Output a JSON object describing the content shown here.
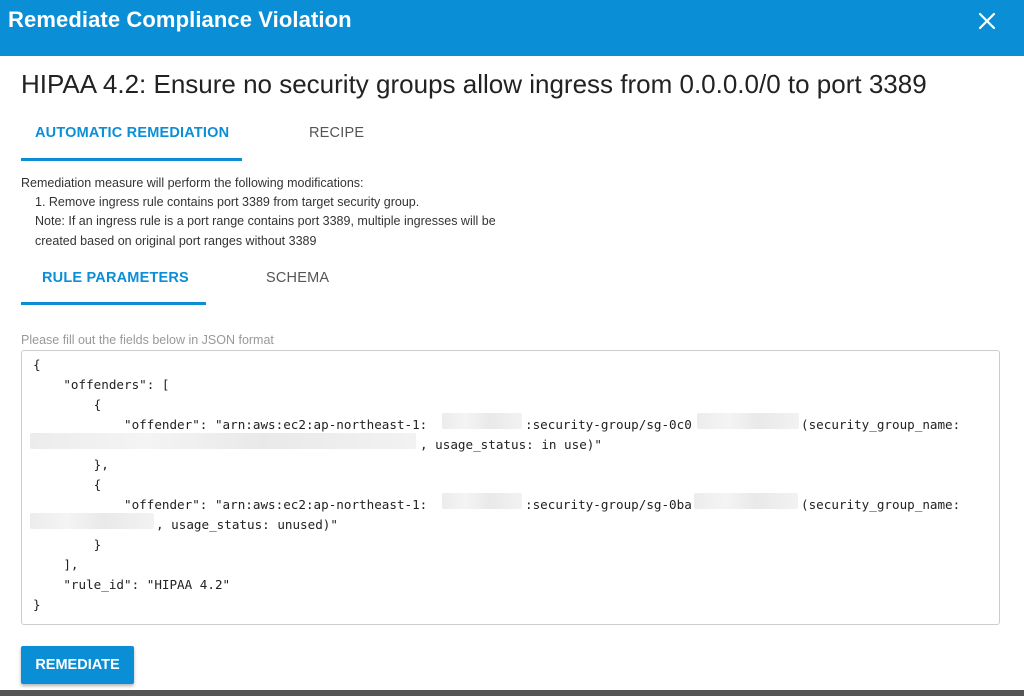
{
  "dialog": {
    "title": "Remediate Compliance Violation",
    "close_icon": "close-icon"
  },
  "heading": "HIPAA 4.2: Ensure no security groups allow ingress from 0.0.0.0/0 to port 3389",
  "tabs": [
    {
      "label": "AUTOMATIC REMEDIATION",
      "active": true
    },
    {
      "label": "RECIPE",
      "active": false
    }
  ],
  "description": {
    "line1": "Remediation measure will perform the following modifications:",
    "line2": "1. Remove ingress rule contains port 3389 from target security group.",
    "line3": "Note: If an ingress rule is a port range contains port 3389, multiple ingresses will be",
    "line4": "created based on original port ranges without 3389"
  },
  "subtabs": [
    {
      "label": "RULE PARAMETERS",
      "active": true
    },
    {
      "label": "SCHEMA",
      "active": false
    }
  ],
  "editor": {
    "hint": "Please fill out the fields below in JSON format",
    "lines": [
      "{",
      "    \"offenders\": [",
      "        {",
      "            \"offender\": \"arn:aws:ec2:ap-northeast-1:",
      ":security-group/sg-0c0",
      "(security_group_name:",
      ", usage_status: in use)\"",
      "        },",
      "        {",
      "            \"offender\": \"arn:aws:ec2:ap-northeast-1:",
      ":security-group/sg-0ba",
      "(security_group_name:",
      ", usage_status: unused)\"",
      "        }",
      "    ],",
      "    \"rule_id\": \"HIPAA 4.2\"",
      "}"
    ]
  },
  "remediate_button": "REMEDIATE",
  "colors": {
    "accent": "#0a8fd6",
    "text": "#222222",
    "muted": "#999999"
  }
}
